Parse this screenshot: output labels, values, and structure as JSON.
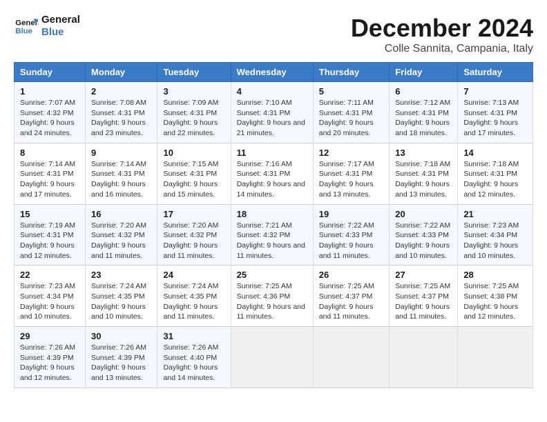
{
  "logo": {
    "line1": "General",
    "line2": "Blue"
  },
  "title": "December 2024",
  "location": "Colle Sannita, Campania, Italy",
  "weekdays": [
    "Sunday",
    "Monday",
    "Tuesday",
    "Wednesday",
    "Thursday",
    "Friday",
    "Saturday"
  ],
  "weeks": [
    [
      {
        "day": "1",
        "sunrise": "7:07 AM",
        "sunset": "4:32 PM",
        "daylight": "9 hours and 24 minutes."
      },
      {
        "day": "2",
        "sunrise": "7:08 AM",
        "sunset": "4:31 PM",
        "daylight": "9 hours and 23 minutes."
      },
      {
        "day": "3",
        "sunrise": "7:09 AM",
        "sunset": "4:31 PM",
        "daylight": "9 hours and 22 minutes."
      },
      {
        "day": "4",
        "sunrise": "7:10 AM",
        "sunset": "4:31 PM",
        "daylight": "9 hours and 21 minutes."
      },
      {
        "day": "5",
        "sunrise": "7:11 AM",
        "sunset": "4:31 PM",
        "daylight": "9 hours and 20 minutes."
      },
      {
        "day": "6",
        "sunrise": "7:12 AM",
        "sunset": "4:31 PM",
        "daylight": "9 hours and 18 minutes."
      },
      {
        "day": "7",
        "sunrise": "7:13 AM",
        "sunset": "4:31 PM",
        "daylight": "9 hours and 17 minutes."
      }
    ],
    [
      {
        "day": "8",
        "sunrise": "7:14 AM",
        "sunset": "4:31 PM",
        "daylight": "9 hours and 17 minutes."
      },
      {
        "day": "9",
        "sunrise": "7:14 AM",
        "sunset": "4:31 PM",
        "daylight": "9 hours and 16 minutes."
      },
      {
        "day": "10",
        "sunrise": "7:15 AM",
        "sunset": "4:31 PM",
        "daylight": "9 hours and 15 minutes."
      },
      {
        "day": "11",
        "sunrise": "7:16 AM",
        "sunset": "4:31 PM",
        "daylight": "9 hours and 14 minutes."
      },
      {
        "day": "12",
        "sunrise": "7:17 AM",
        "sunset": "4:31 PM",
        "daylight": "9 hours and 13 minutes."
      },
      {
        "day": "13",
        "sunrise": "7:18 AM",
        "sunset": "4:31 PM",
        "daylight": "9 hours and 13 minutes."
      },
      {
        "day": "14",
        "sunrise": "7:18 AM",
        "sunset": "4:31 PM",
        "daylight": "9 hours and 12 minutes."
      }
    ],
    [
      {
        "day": "15",
        "sunrise": "7:19 AM",
        "sunset": "4:31 PM",
        "daylight": "9 hours and 12 minutes."
      },
      {
        "day": "16",
        "sunrise": "7:20 AM",
        "sunset": "4:32 PM",
        "daylight": "9 hours and 11 minutes."
      },
      {
        "day": "17",
        "sunrise": "7:20 AM",
        "sunset": "4:32 PM",
        "daylight": "9 hours and 11 minutes."
      },
      {
        "day": "18",
        "sunrise": "7:21 AM",
        "sunset": "4:32 PM",
        "daylight": "9 hours and 11 minutes."
      },
      {
        "day": "19",
        "sunrise": "7:22 AM",
        "sunset": "4:33 PM",
        "daylight": "9 hours and 11 minutes."
      },
      {
        "day": "20",
        "sunrise": "7:22 AM",
        "sunset": "4:33 PM",
        "daylight": "9 hours and 10 minutes."
      },
      {
        "day": "21",
        "sunrise": "7:23 AM",
        "sunset": "4:34 PM",
        "daylight": "9 hours and 10 minutes."
      }
    ],
    [
      {
        "day": "22",
        "sunrise": "7:23 AM",
        "sunset": "4:34 PM",
        "daylight": "9 hours and 10 minutes."
      },
      {
        "day": "23",
        "sunrise": "7:24 AM",
        "sunset": "4:35 PM",
        "daylight": "9 hours and 10 minutes."
      },
      {
        "day": "24",
        "sunrise": "7:24 AM",
        "sunset": "4:35 PM",
        "daylight": "9 hours and 11 minutes."
      },
      {
        "day": "25",
        "sunrise": "7:25 AM",
        "sunset": "4:36 PM",
        "daylight": "9 hours and 11 minutes."
      },
      {
        "day": "26",
        "sunrise": "7:25 AM",
        "sunset": "4:37 PM",
        "daylight": "9 hours and 11 minutes."
      },
      {
        "day": "27",
        "sunrise": "7:25 AM",
        "sunset": "4:37 PM",
        "daylight": "9 hours and 11 minutes."
      },
      {
        "day": "28",
        "sunrise": "7:25 AM",
        "sunset": "4:38 PM",
        "daylight": "9 hours and 12 minutes."
      }
    ],
    [
      {
        "day": "29",
        "sunrise": "7:26 AM",
        "sunset": "4:39 PM",
        "daylight": "9 hours and 12 minutes."
      },
      {
        "day": "30",
        "sunrise": "7:26 AM",
        "sunset": "4:39 PM",
        "daylight": "9 hours and 13 minutes."
      },
      {
        "day": "31",
        "sunrise": "7:26 AM",
        "sunset": "4:40 PM",
        "daylight": "9 hours and 14 minutes."
      },
      null,
      null,
      null,
      null
    ]
  ],
  "labels": {
    "sunrise_prefix": "Sunrise: ",
    "sunset_prefix": "Sunset: ",
    "daylight_prefix": "Daylight: "
  }
}
